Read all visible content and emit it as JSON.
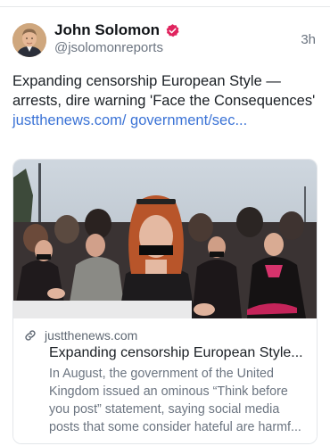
{
  "author": {
    "display_name": "John Solomon",
    "handle": "@jsolomonreports",
    "verified": true,
    "verified_color": "#e0245e",
    "avatar_icon": "profile-photo"
  },
  "post": {
    "timestamp": "3h",
    "text": "Expanding censorship European Style — arrests, dire warning 'Face the Consequences' ",
    "link_text": "justthenews.com/ government/sec...",
    "link_color": "#3b73d6"
  },
  "link_card": {
    "image_alt": "Protesters with black tape over their mouths",
    "link_icon": "link-icon",
    "domain": "justthenews.com",
    "title": "Expanding censorship European Style...",
    "description": "In August, the government of the United Kingdom issued an ominous “Think before you post” statement, saying social media posts that some consider hateful are harmf..."
  }
}
